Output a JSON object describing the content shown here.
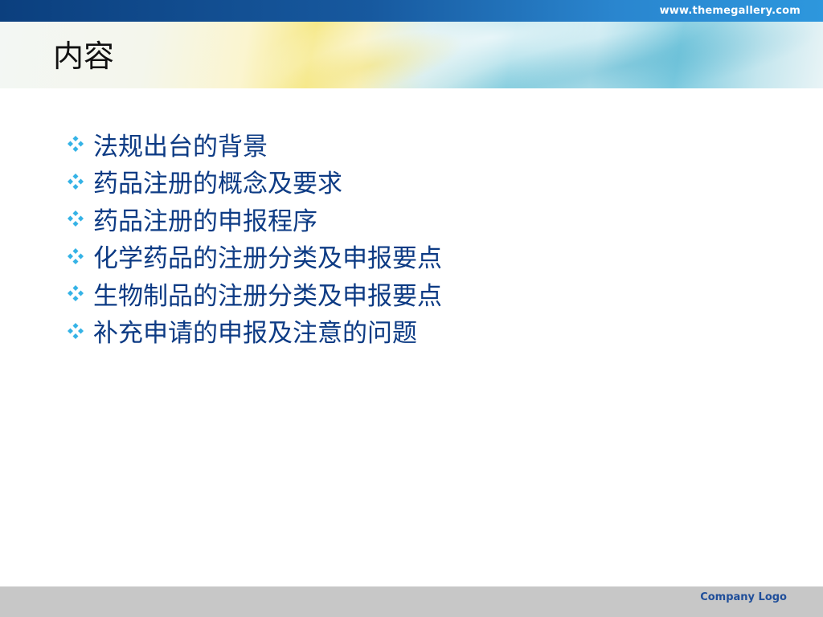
{
  "header": {
    "site_url": "www.themegallery.com",
    "title": "内容"
  },
  "bullet_icon": "diamond-cluster-icon",
  "colors": {
    "top_bar": "#17599f",
    "bullet_text": "#0d3b84",
    "bullet_icon": "#35b3e6",
    "footer": "#c7c7c7",
    "footer_text": "#1f4e9a"
  },
  "bullets": [
    {
      "text": "法规出台的背景"
    },
    {
      "text": "药品注册的概念及要求"
    },
    {
      "text": "药品注册的申报程序"
    },
    {
      "text": "化学药品的注册分类及申报要点"
    },
    {
      "text": "生物制品的注册分类及申报要点"
    },
    {
      "text": "补充申请的申报及注意的问题"
    }
  ],
  "footer": {
    "company_logo": "Company Logo"
  }
}
